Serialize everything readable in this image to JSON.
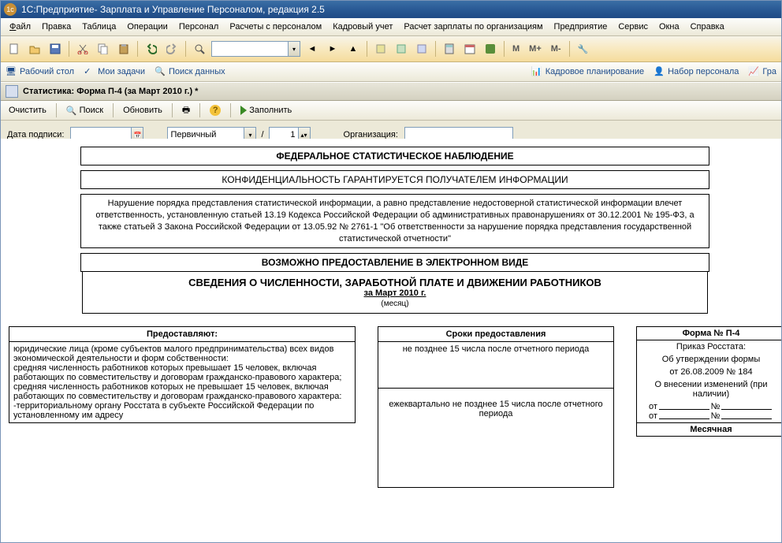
{
  "titlebar": {
    "app_name": "1С:Предприятие",
    "title": " - Зарплата и Управление Персоналом, редакция 2.5"
  },
  "menu": {
    "file": "Файл",
    "edit": "Правка",
    "table": "Таблица",
    "operations": "Операции",
    "personnel": "Персонал",
    "calc": "Расчеты с персоналом",
    "hr": "Кадровый учет",
    "payroll": "Расчет зарплаты по организациям",
    "enterprise": "Предприятие",
    "service": "Сервис",
    "windows": "Окна",
    "help": "Справка"
  },
  "toolbar": {
    "m": "M",
    "m_plus": "M+",
    "m_minus": "M-"
  },
  "tabs": {
    "desktop": "Рабочий стол",
    "my_tasks": "Мои задачи",
    "search": "Поиск данных",
    "hr_plan": "Кадровое планирование",
    "recruit": "Набор персонала",
    "gra": "Гра"
  },
  "doc": {
    "title": "Статистика: Форма П-4 (за Март 2010 г.) *"
  },
  "doc_toolbar": {
    "clear": "Очистить",
    "search": "Поиск",
    "refresh": "Обновить",
    "fill": "Заполнить"
  },
  "params": {
    "date_sign_label": "Дата подписи:",
    "date_sign_value": "",
    "periodicity": "Первичный",
    "slash": "/",
    "seq": "1",
    "org_label": "Организация:",
    "org_value": ""
  },
  "report": {
    "hdr1": "ФЕДЕРАЛЬНОЕ СТАТИСТИЧЕСКОЕ НАБЛЮДЕНИЕ",
    "hdr2": "КОНФИДЕНЦИАЛЬНОСТЬ ГАРАНТИРУЕТСЯ ПОЛУЧАТЕЛЕМ ИНФОРМАЦИИ",
    "note": "Нарушение порядка представления статистической информации, а равно представление недостоверной статистической информации влечет ответственность, установленную статьей 13.19 Кодекса Российской Федерации об административных правонарушениях от 30.12.2001 № 195-ФЗ, а также статьей 3 Закона Российской Федерации от 13.05.92 № 2761-1 \"Об ответственности за нарушение порядка представления государственной статистической отчетности\"",
    "hdr3": "ВОЗМОЖНО ПРЕДОСТАВЛЕНИЕ В ЭЛЕКТРОННОМ ВИДЕ",
    "title": "СВЕДЕНИЯ О ЧИСЛЕННОСТИ, ЗАРАБОТНОЙ ПЛАТЕ И ДВИЖЕНИИ РАБОТНИКОВ",
    "sub": "за Март 2010 г.",
    "month_hint": "(месяц)"
  },
  "table_left": {
    "h1": "Предоставляют:",
    "h2": "Сроки предоставления",
    "r1c1": "юридические лица (кроме субъектов малого предпринимательства) всех видов экономической деятельности и форм собственности:\n   средняя численность работников которых превышает 15 человек, включая работающих по совместительству и договорам гражданско-правового характера;\n   средняя численность работников которых не превышает 15 человек, включая работающих по совместительству и договорам гражданско-правового характера:\n      -территориальному органу Росстата в субъекте Российской Федерации по установленному им адресу",
    "r1c2a": "не позднее 15 числа после отчетного периода",
    "r1c2b": "ежеквартально не позднее 15 числа после отчетного периода"
  },
  "form_card": {
    "form_no": "Форма № П-4",
    "order1": "Приказ Росстата:",
    "order2": "Об утверждении формы",
    "order3": "от 26.08.2009 № 184",
    "order4": "О внесении изменений (при наличии)",
    "from": "от",
    "no": "№",
    "periodicity": "Месячная"
  }
}
